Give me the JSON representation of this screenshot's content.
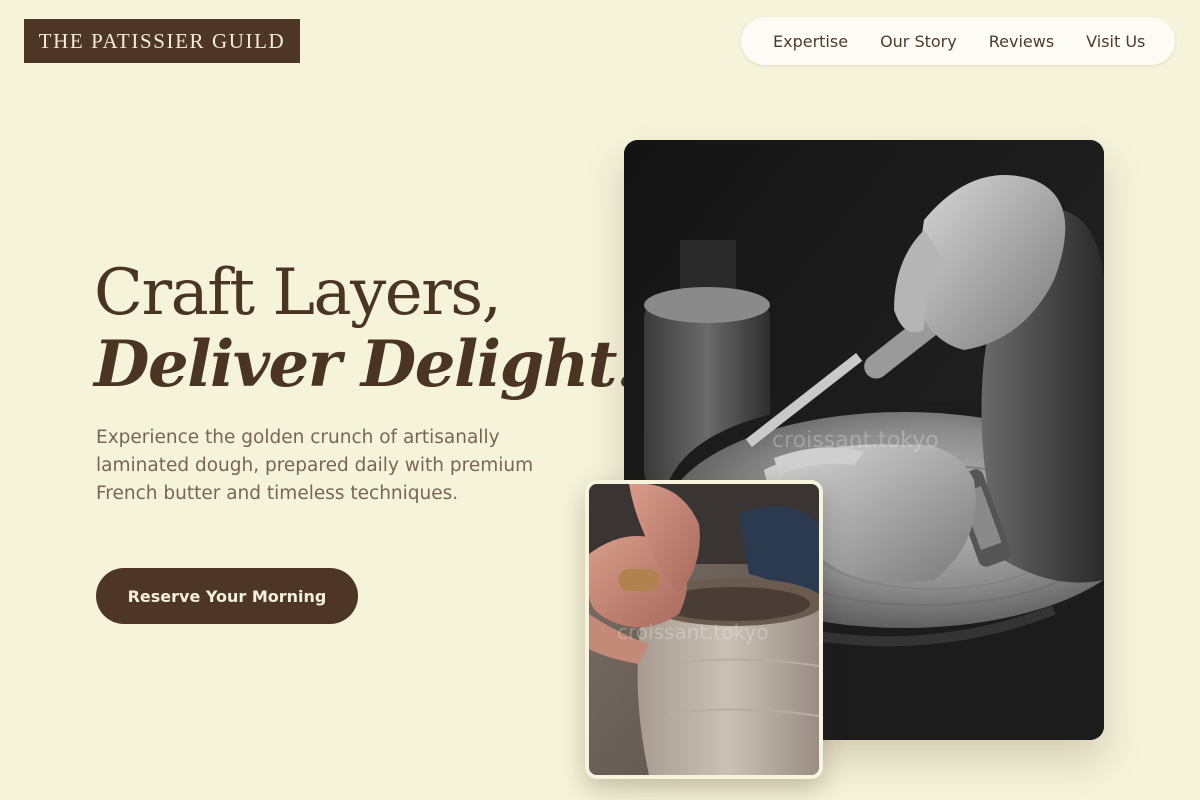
{
  "brand": {
    "name": "THE PATISSIER GUILD"
  },
  "nav": {
    "items": [
      {
        "label": "Expertise"
      },
      {
        "label": "Our Story"
      },
      {
        "label": "Reviews"
      },
      {
        "label": "Visit Us"
      }
    ]
  },
  "hero": {
    "headline_line1": "Craft Layers,",
    "headline_line2": "Deliver Delight.",
    "description": "Experience the golden crunch of artisanally laminated dough, prepared daily with premium French butter and timeless techniques.",
    "cta_label": "Reserve Your Morning"
  },
  "images": {
    "main": {
      "alt": "Black and white photo of hands carving wood with a chisel",
      "watermark": "croissant.tokyo"
    },
    "secondary": {
      "alt": "Hands shaping clay on a pottery wheel",
      "watermark": "croissant.tokyo"
    }
  },
  "colors": {
    "background": "#f5f3d9",
    "brand_dark": "#4e3626",
    "nav_bg": "#fdfcf4",
    "body_text": "#7a6552"
  }
}
